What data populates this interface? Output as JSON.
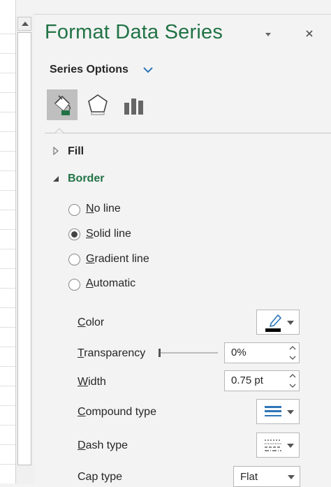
{
  "pane": {
    "title": "Format Data Series",
    "options_label": "Series Options"
  },
  "tabs": [
    {
      "icon": "fill-line-icon",
      "selected": true
    },
    {
      "icon": "effects-icon",
      "selected": false
    },
    {
      "icon": "series-options-icon",
      "selected": false
    }
  ],
  "sections": {
    "fill": {
      "label": "Fill",
      "expanded": false
    },
    "border": {
      "label": "Border",
      "expanded": true
    }
  },
  "border_options": [
    {
      "label": "No line",
      "mnemonic": "N",
      "rest": "o line",
      "checked": false
    },
    {
      "label": "Solid line",
      "mnemonic": "S",
      "rest": "olid line",
      "checked": true
    },
    {
      "label": "Gradient line",
      "mnemonic": "G",
      "rest": "radient line",
      "checked": false
    },
    {
      "label": "Automatic",
      "mnemonic": "A",
      "rest": "utomatic",
      "checked": false
    }
  ],
  "properties": {
    "color": {
      "mnemonic": "C",
      "rest": "olor",
      "swatch_color": "#000000"
    },
    "transparency": {
      "mnemonic": "T",
      "rest": "ransparency",
      "value": "0%",
      "slider_fraction": 0
    },
    "width": {
      "mnemonic": "W",
      "rest": "idth",
      "value": "0.75 pt"
    },
    "compound_type": {
      "mnemonic": "C",
      "rest": "ompound type"
    },
    "dash_type": {
      "mnemonic": "D",
      "rest": "ash type"
    },
    "cap_type": {
      "mnemonic": "",
      "rest": "Cap type",
      "value": "Flat"
    }
  },
  "colors": {
    "accent": "#217346",
    "compound_lines": "#2e75b6"
  }
}
